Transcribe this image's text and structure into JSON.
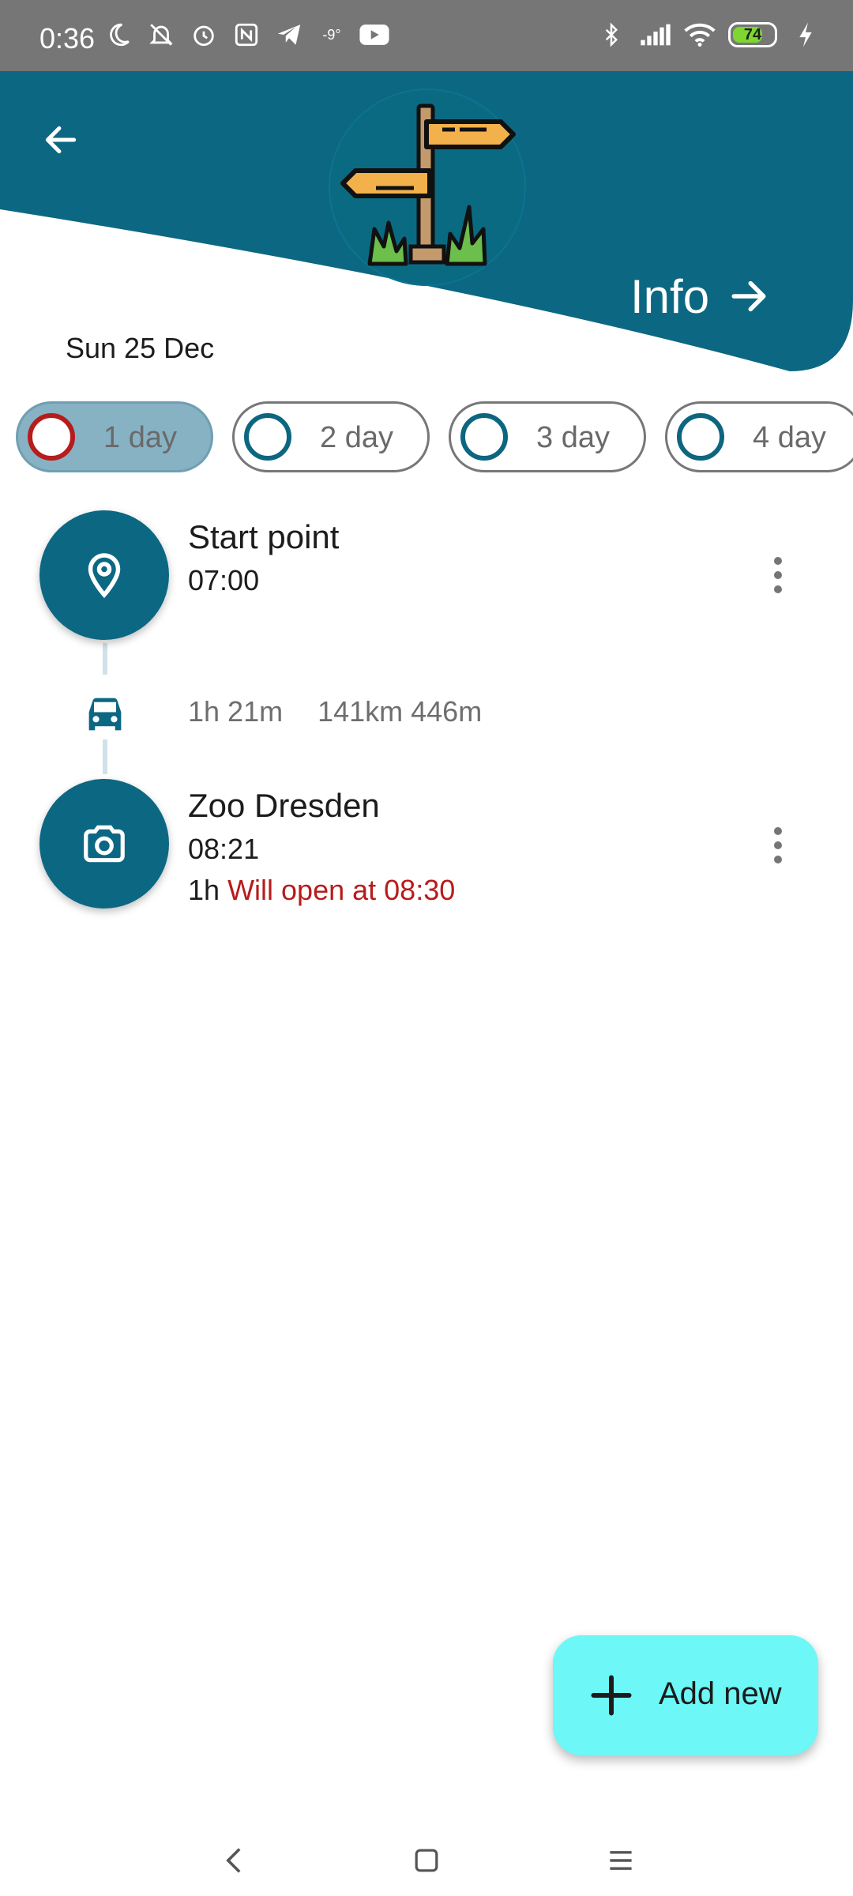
{
  "status_bar": {
    "time": "0:36",
    "temperature": "-9°",
    "battery": "74",
    "icons_left": [
      "moon-icon",
      "bell-off-icon",
      "alarm-icon",
      "nfc-icon",
      "telegram-icon",
      "youtube-icon"
    ],
    "icons_right": [
      "bluetooth-icon",
      "signal-icon",
      "wifi-icon",
      "battery-icon",
      "charging-icon"
    ]
  },
  "header": {
    "back_icon": "arrow-left-icon",
    "logo": "signpost-icon",
    "info_label": "Info",
    "info_icon": "arrow-right-icon",
    "date": "Sun 25 Dec",
    "colors": {
      "primary": "#0c6782",
      "accent_red": "#b71c1c",
      "fab": "#6df7f7"
    }
  },
  "days": [
    {
      "label": "1 day",
      "selected": true
    },
    {
      "label": "2 day",
      "selected": false
    },
    {
      "label": "3 day",
      "selected": false
    },
    {
      "label": "4 day",
      "selected": false
    }
  ],
  "timeline": {
    "items": [
      {
        "icon": "location-pin-icon",
        "title": "Start point",
        "time": "07:00"
      },
      {
        "icon": "camera-icon",
        "title": "Zoo Dresden",
        "time": "08:21",
        "duration": "1h",
        "note": "Will open at 08:30"
      }
    ],
    "travel": {
      "icon": "car-icon",
      "duration": "1h 21m",
      "distance": "141km 446m"
    }
  },
  "fab": {
    "icon": "plus-icon",
    "label": "Add new"
  },
  "nav_bar": {
    "back": "nav-back-icon",
    "home": "nav-home-icon",
    "menu": "nav-menu-icon"
  }
}
